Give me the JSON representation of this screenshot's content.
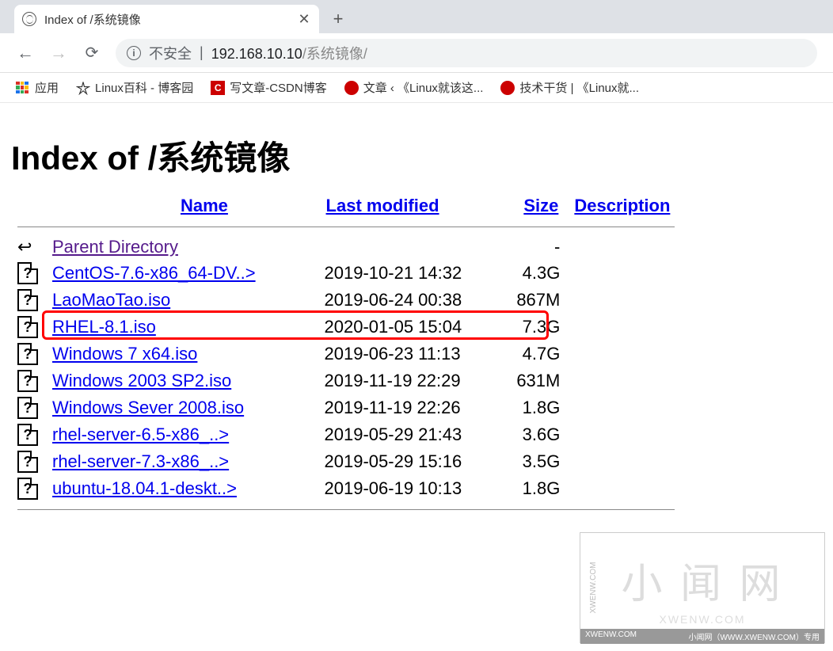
{
  "tab": {
    "title": "Index of /系统镜像"
  },
  "toolbar": {
    "insecure_label": "不安全",
    "url_domain": "192.168.10.10",
    "url_path": "/系统镜像/"
  },
  "bookmarks": {
    "apps": "应用",
    "items": [
      {
        "label": "Linux百科 - 博客园"
      },
      {
        "label": "写文章-CSDN博客"
      },
      {
        "label": "文章 ‹ 《Linux就该这..."
      },
      {
        "label": "技术干货 | 《Linux就..."
      }
    ]
  },
  "page": {
    "heading": "Index of /系统镜像",
    "columns": {
      "name": "Name",
      "modified": "Last modified",
      "size": "Size",
      "description": "Description"
    },
    "parent": {
      "label": "Parent Directory",
      "size": "-"
    },
    "files": [
      {
        "name": "CentOS-7.6-x86_64-DV..>",
        "modified": "2019-10-21 14:32",
        "size": "4.3G",
        "highlighted": false
      },
      {
        "name": "LaoMaoTao.iso",
        "modified": "2019-06-24 00:38",
        "size": "867M",
        "highlighted": false
      },
      {
        "name": "RHEL-8.1.iso",
        "modified": "2020-01-05 15:04",
        "size": "7.3G",
        "highlighted": true
      },
      {
        "name": "Windows 7 x64.iso",
        "modified": "2019-06-23 11:13",
        "size": "4.7G",
        "highlighted": false
      },
      {
        "name": "Windows 2003 SP2.iso",
        "modified": "2019-11-19 22:29",
        "size": "631M",
        "highlighted": false
      },
      {
        "name": "Windows Sever 2008.iso",
        "modified": "2019-11-19 22:26",
        "size": "1.8G",
        "highlighted": false
      },
      {
        "name": "rhel-server-6.5-x86_..>",
        "modified": "2019-05-29 21:43",
        "size": "3.6G",
        "highlighted": false
      },
      {
        "name": "rhel-server-7.3-x86_..>",
        "modified": "2019-05-29 15:16",
        "size": "3.5G",
        "highlighted": false
      },
      {
        "name": "ubuntu-18.04.1-deskt..>",
        "modified": "2019-06-19 10:13",
        "size": "1.8G",
        "highlighted": false
      }
    ]
  },
  "watermark": {
    "big": "小 闻 网",
    "small": "XWENW.COM",
    "side": "XWENW.COM",
    "bottom_left": "XWENW.COM",
    "bottom_right": "小闻网（WWW.XWENW.COM）专用"
  }
}
